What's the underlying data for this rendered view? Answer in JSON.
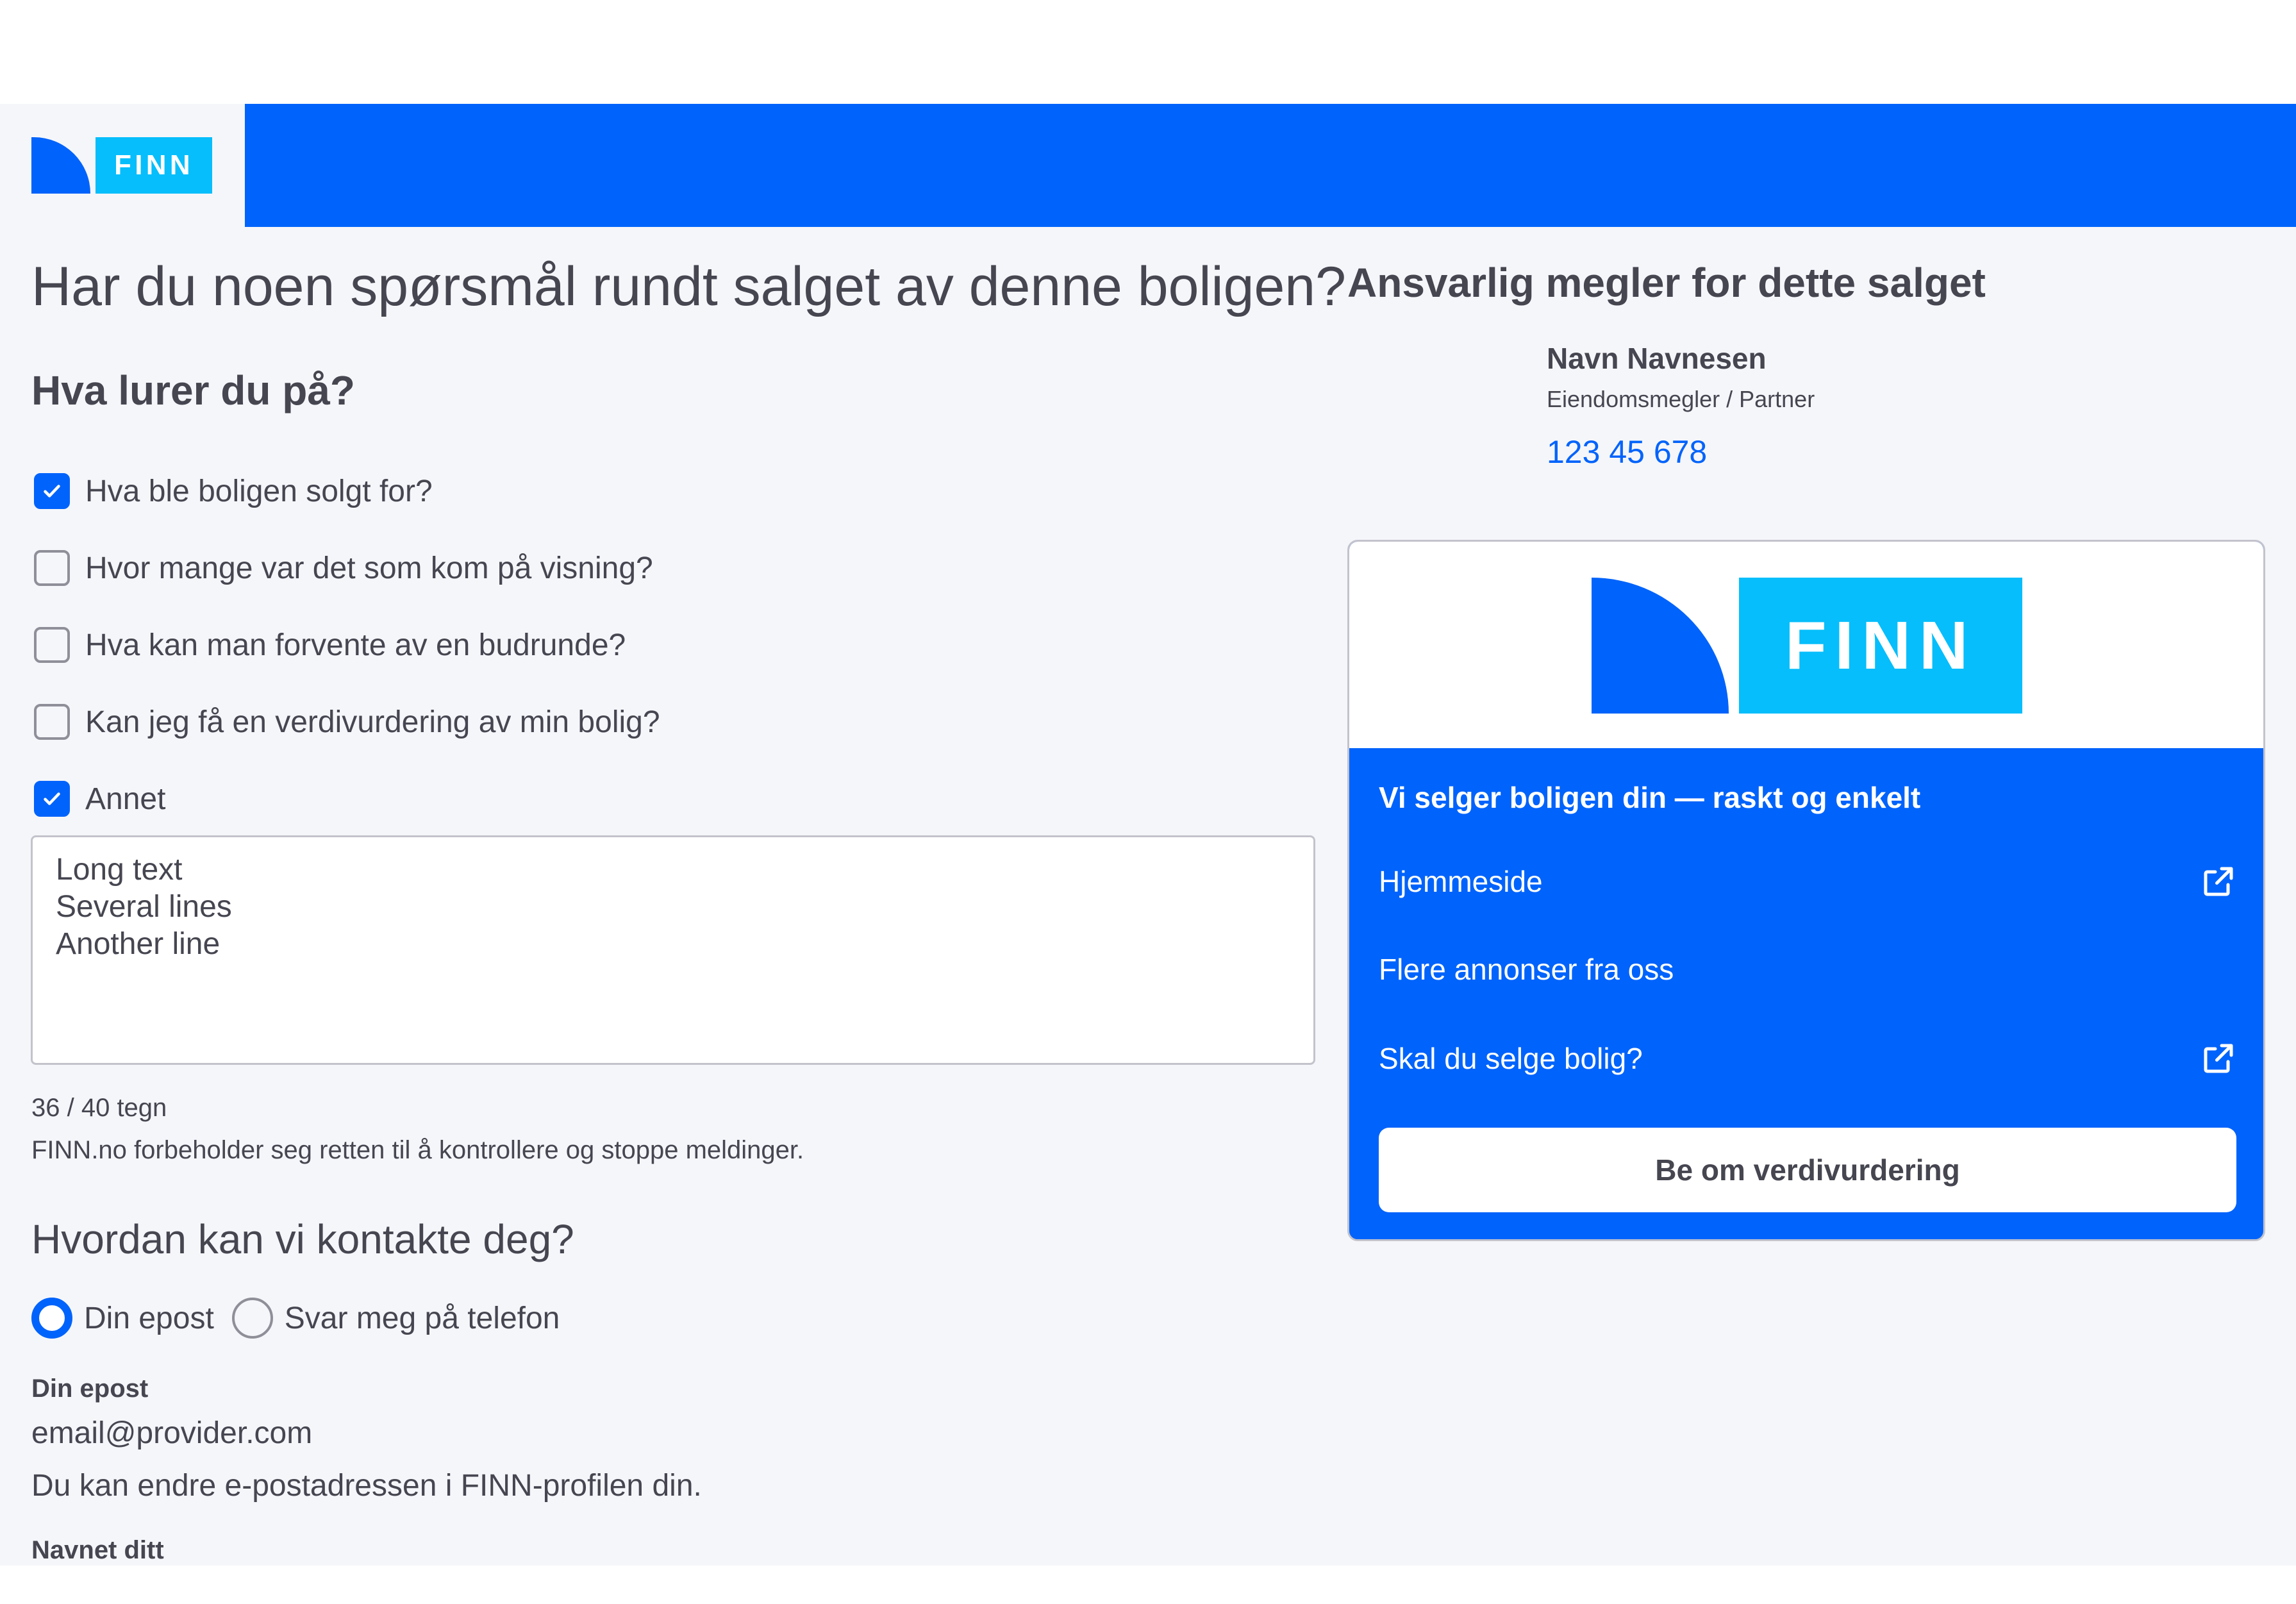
{
  "header": {
    "logo_text": "FINN",
    "brand_color": "#0063fb",
    "logo_accent_color": "#06befb"
  },
  "form": {
    "title": "Har du noen spørsmål rundt salget av denne boligen?",
    "question_heading": "Hva lurer du på?",
    "options": [
      {
        "label": "Hva ble boligen solgt for?",
        "checked": true
      },
      {
        "label": "Hvor mange var det som kom på visning?",
        "checked": false
      },
      {
        "label": "Hva kan man forvente av en budrunde?",
        "checked": false
      },
      {
        "label": "Kan jeg få en verdivurdering av min bolig?",
        "checked": false
      },
      {
        "label": "Annet",
        "checked": true
      }
    ],
    "message_value": "Long text\nSeveral lines\nAnother line",
    "char_counter": "36 / 40 tegn",
    "disclaimer": "FINN.no forbeholder seg retten til å kontrollere og stoppe meldinger.",
    "contact_heading": "Hvordan kan vi kontakte deg?",
    "contact_options": [
      {
        "label": "Din epost",
        "selected": true
      },
      {
        "label": "Svar meg på telefon",
        "selected": false
      }
    ],
    "email_label": "Din epost",
    "email_value": "email@provider.com",
    "email_help": "Du kan endre e-postadressen i FINN-profilen din.",
    "name_label": "Navnet ditt"
  },
  "agent": {
    "heading": "Ansvarlig megler for dette salget",
    "name": "Navn Navnesen",
    "role": "Eiendomsmegler / Partner",
    "phone": "123 45 678"
  },
  "card": {
    "logo_text": "FINN",
    "headline": "Vi selger boligen din — raskt og enkelt",
    "links": [
      {
        "label": "Hjemmeside",
        "icon": "external-link-icon"
      },
      {
        "label": "Flere annonser fra oss",
        "icon": null
      },
      {
        "label": "Skal du selge bolig?",
        "icon": "external-link-icon"
      }
    ],
    "button_label": "Be om verdivurdering"
  }
}
